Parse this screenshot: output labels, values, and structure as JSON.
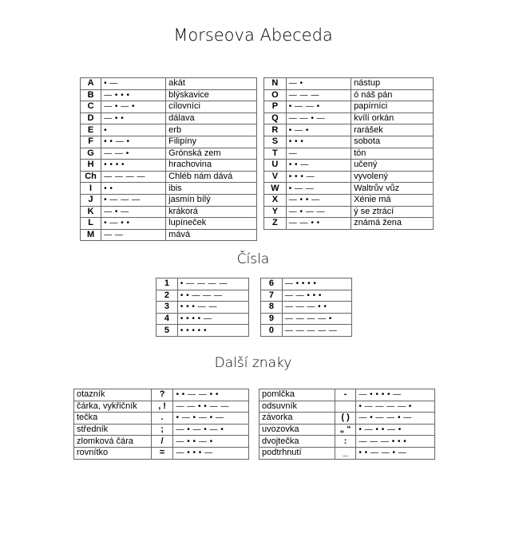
{
  "title": "Morseova Abeceda",
  "letters_left": [
    [
      "A",
      "• —",
      "akát"
    ],
    [
      "B",
      "— • • •",
      "blýskavice"
    ],
    [
      "C",
      "— • — •",
      "cílovníci"
    ],
    [
      "D",
      "— • •",
      "dálava"
    ],
    [
      "E",
      "•",
      "erb"
    ],
    [
      "F",
      "• • — •",
      "Filipíny"
    ],
    [
      "G",
      "— — •",
      "Grónská zem"
    ],
    [
      "H",
      "• • • •",
      "hrachovina"
    ],
    [
      "Ch",
      "— — — —",
      "Chléb nám dává"
    ],
    [
      "I",
      "• •",
      "ibis"
    ],
    [
      "J",
      "• — — —",
      "jasmín bílý"
    ],
    [
      "K",
      "— • —",
      "krákorá"
    ],
    [
      "L",
      "• — • •",
      "lupíneček"
    ],
    [
      "M",
      "— —",
      "mává"
    ]
  ],
  "letters_right": [
    [
      "N",
      "— •",
      "nástup"
    ],
    [
      "O",
      "— — —",
      "ó náš pán"
    ],
    [
      "P",
      "• — — •",
      "papírníci"
    ],
    [
      "Q",
      "— — • —",
      "kvílí orkán"
    ],
    [
      "R",
      "• — •",
      "rarášek"
    ],
    [
      "S",
      "• • •",
      "sobota"
    ],
    [
      "T",
      "—",
      "tón"
    ],
    [
      "U",
      "• • —",
      "učený"
    ],
    [
      "V",
      "• • • —",
      "vyvolený"
    ],
    [
      "W",
      "• — —",
      "Waltrův vůz"
    ],
    [
      "X",
      "— • • —",
      "Xénie má"
    ],
    [
      "Y",
      "— • — —",
      "ý se ztrácí"
    ],
    [
      "Z",
      "— — • •",
      "známá žena"
    ]
  ],
  "numbers_title": "Čísla",
  "numbers_left": [
    [
      "1",
      "• — — — —"
    ],
    [
      "2",
      "• • — — —"
    ],
    [
      "3",
      "• • • — —"
    ],
    [
      "4",
      "• • • • —"
    ],
    [
      "5",
      "• • • • •"
    ]
  ],
  "numbers_right": [
    [
      "6",
      "— • • • •"
    ],
    [
      "7",
      "— — • • •"
    ],
    [
      "8",
      "— — — • •"
    ],
    [
      "9",
      "— — — — •"
    ],
    [
      "0",
      "— — — — —"
    ]
  ],
  "other_title": "Další znaky",
  "other_left": [
    [
      "otazník",
      "?",
      "• • — — • •"
    ],
    [
      "čárka, vykřičník",
      ", !",
      "— — • • — —"
    ],
    [
      "tečka",
      ".",
      "• — • — • —"
    ],
    [
      "středník",
      ";",
      "— • — • — •"
    ],
    [
      "zlomková čára",
      "/",
      "— • • — •"
    ],
    [
      "rovnítko",
      "=",
      "— • • • —"
    ]
  ],
  "other_right": [
    [
      "pomlčka",
      "-",
      "— • • • • —"
    ],
    [
      "odsuvník",
      "",
      "• — — — — •"
    ],
    [
      "závorka",
      "( )",
      "— • — — • —"
    ],
    [
      "uvozovka",
      "„ “",
      "• — • • — •"
    ],
    [
      "dvojtečka",
      ":",
      "— — — • • •"
    ],
    [
      "podtrhnutí",
      "_",
      "• • — — • —"
    ]
  ]
}
